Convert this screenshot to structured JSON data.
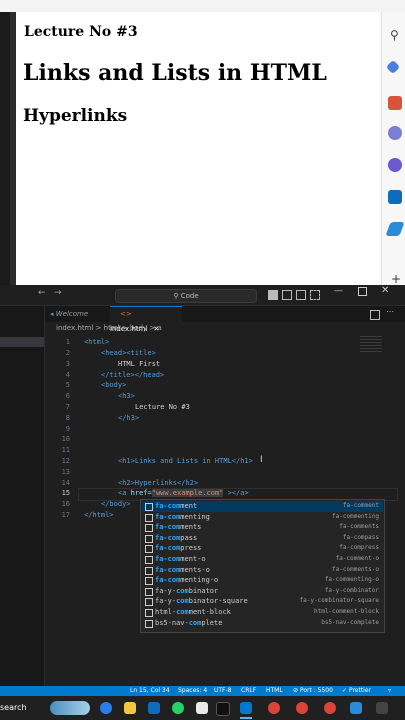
{
  "browser": {
    "page_h3": "Lecture No #3",
    "page_h1": "Links and Lists in HTML",
    "page_h2": "Hyperlinks"
  },
  "vscode": {
    "command_center": "Code",
    "tabs": [
      {
        "label": "Welcome"
      },
      {
        "label": "index.html"
      }
    ],
    "breadcrumb": "index.html > html > body > a",
    "line_numbers": [
      "1",
      "2",
      "3",
      "4",
      "5",
      "6",
      "7",
      "8",
      "9",
      "10",
      "11",
      "12",
      "13",
      "14",
      "15",
      "16",
      "17"
    ],
    "code": {
      "l1": "<html>",
      "l2": "<head><title>",
      "l3": "HTML First",
      "l4": "</title></head>",
      "l5": "<body>",
      "l6": "<h3>",
      "l7": "Lecture No #3",
      "l8": "</h3>",
      "l12": "<h1>Links and Lists in HTML</h1>",
      "l14": "<h2>Hyperlinks</h2>",
      "l15a": "<a ",
      "l15b": "href=",
      "l15c": "\"www.example.com\"",
      "l15d": " ></a>",
      "l16": "</body>",
      "l17": "</html>"
    },
    "suggestions": [
      {
        "label": "fa-comment",
        "detail": "fa-comment"
      },
      {
        "label": "fa-commenting",
        "detail": "fa-commenting"
      },
      {
        "label": "fa-comments",
        "detail": "fa-comments"
      },
      {
        "label": "fa-compass",
        "detail": "fa-compass"
      },
      {
        "label": "fa-compress",
        "detail": "fa-compress"
      },
      {
        "label": "fa-comment-o",
        "detail": "fa-comment-o"
      },
      {
        "label": "fa-comments-o",
        "detail": "fa-comments-o"
      },
      {
        "label": "fa-commenting-o",
        "detail": "fa-commenting-o"
      },
      {
        "label": "fa-y-combinator",
        "detail": "fa-y-combinator"
      },
      {
        "label": "fa-y-combinator-square",
        "detail": "fa-y-combinator-square"
      },
      {
        "label": "html-comment-block",
        "detail": "html-comment-block"
      },
      {
        "label": "bs5-nav-complete",
        "detail": "bs5-nav-complete"
      }
    ],
    "status": {
      "position": "Ln 15, Col 34",
      "spaces": "Spaces: 4",
      "encoding": "UTF-8",
      "eol": "CRLF",
      "language": "HTML",
      "port": "Port : 5500",
      "prettier": "Prettier"
    }
  },
  "taskbar": {
    "search": "search"
  },
  "colors": {
    "accent": "#007acc",
    "suggest_sel": "#04395e",
    "match": "#2aaaff"
  }
}
